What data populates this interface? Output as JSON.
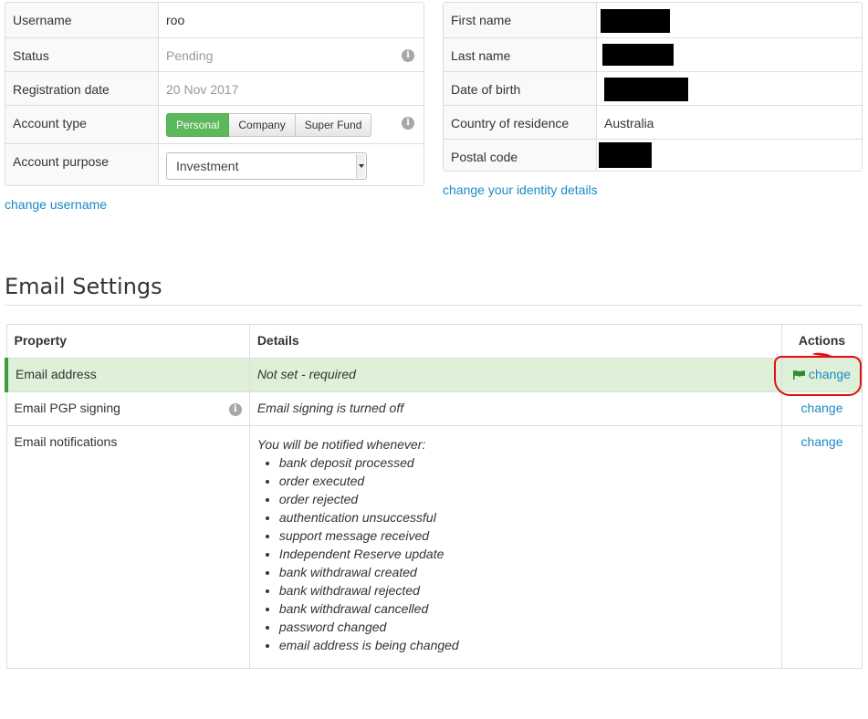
{
  "account": {
    "username_label": "Username",
    "username_value": "roo",
    "status_label": "Status",
    "status_value": "Pending",
    "registration_label": "Registration date",
    "registration_value": "20 Nov 2017",
    "account_type_label": "Account type",
    "account_types": [
      "Personal",
      "Company",
      "Super Fund"
    ],
    "account_purpose_label": "Account purpose",
    "account_purpose_value": "Investment",
    "change_username_link": "change username"
  },
  "identity": {
    "first_name_label": "First name",
    "last_name_label": "Last name",
    "dob_label": "Date of birth",
    "country_label": "Country of residence",
    "country_value": "Australia",
    "postal_code_label": "Postal code",
    "change_identity_link": "change your identity details"
  },
  "email_settings": {
    "title": "Email Settings",
    "headers": [
      "Property",
      "Details",
      "Actions"
    ],
    "rows": [
      {
        "property": "Email address",
        "details": "Not set - required",
        "action": "change"
      },
      {
        "property": "Email PGP signing",
        "details": "Email signing is turned off",
        "action": "change"
      },
      {
        "property": "Email notifications",
        "details": "You will be notified whenever:",
        "action": "change"
      }
    ],
    "notifications": [
      "bank deposit processed",
      "order executed",
      "order rejected",
      "authentication unsuccessful",
      "support message received",
      "Independent Reserve update",
      "bank withdrawal created",
      "bank withdrawal rejected",
      "bank withdrawal cancelled",
      "password changed",
      "email address is being changed"
    ]
  },
  "icons": {
    "info": "info-icon",
    "flag": "flag-icon"
  },
  "colors": {
    "accent": "#5cb85c",
    "link": "#1a8ac6",
    "success_bg": "#dff0d8",
    "annotation": "#e01010"
  }
}
